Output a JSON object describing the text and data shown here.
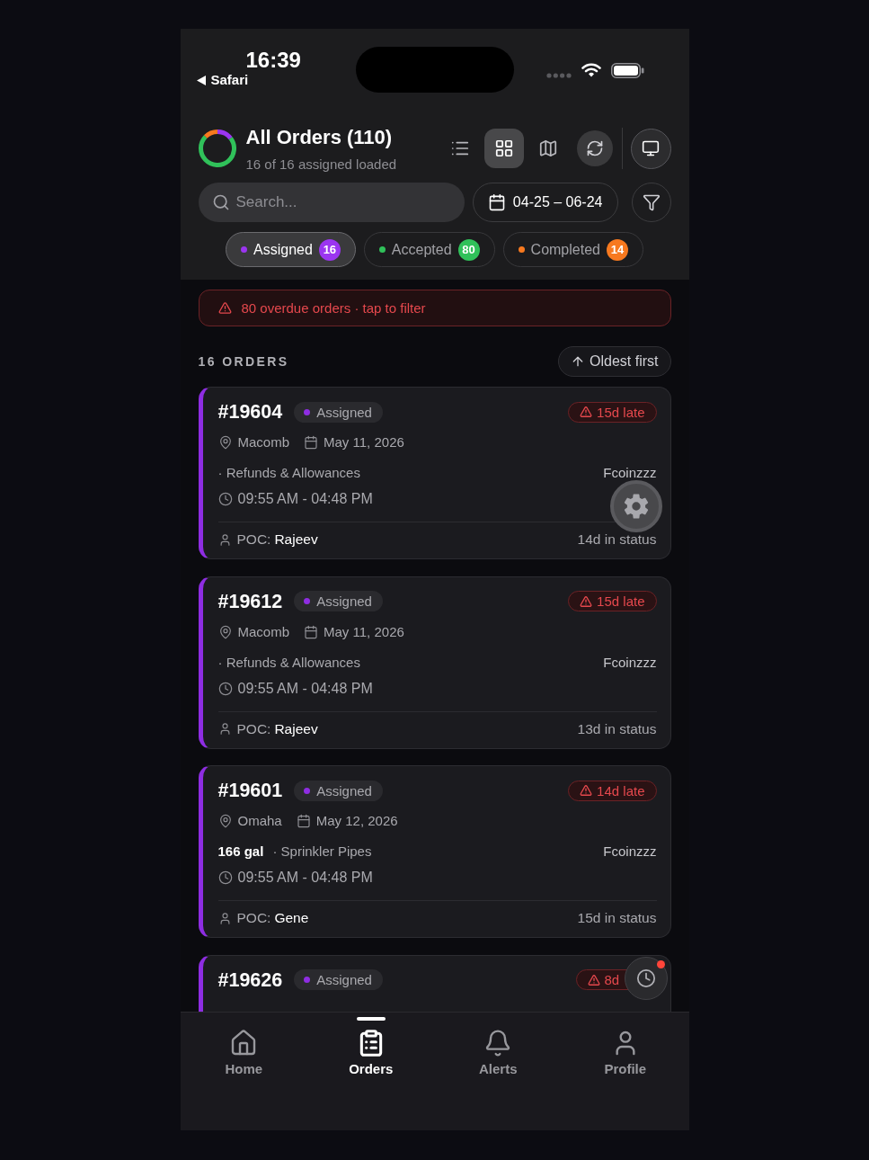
{
  "status_bar": {
    "time": "16:39",
    "back_label": "Safari"
  },
  "header": {
    "title": "All Orders (110)",
    "subtitle": "16 of 16 assigned loaded"
  },
  "view_modes": [
    {
      "kind": "list",
      "selected": false
    },
    {
      "kind": "grid",
      "selected": true
    },
    {
      "kind": "map",
      "selected": false
    }
  ],
  "search": {
    "placeholder": "Search..."
  },
  "date_range": {
    "label": "04-25 – 06-24"
  },
  "status_filters": [
    {
      "label": "Assigned",
      "count": "16",
      "color": "#9b35f0",
      "selected": true
    },
    {
      "label": "Accepted",
      "count": "80",
      "color": "#30c15a",
      "selected": false
    },
    {
      "label": "Completed",
      "count": "14",
      "color": "#f7791f",
      "selected": false
    }
  ],
  "overdue_banner": {
    "text": "80 overdue orders · tap to filter"
  },
  "list_header": {
    "count": "16 ORDERS",
    "sort": "Oldest first"
  },
  "orders": [
    {
      "number": "#19604",
      "status": "Assigned",
      "late": "15d late",
      "location": "Macomb",
      "date": "May 11, 2026",
      "category": "· Refunds & Allowances",
      "vendor": "Fcoinzzz",
      "time": "09:55 AM - 04:48 PM",
      "poc_label": "POC:",
      "poc": "Rajeev",
      "in_status": "14d in status"
    },
    {
      "number": "#19612",
      "status": "Assigned",
      "late": "15d late",
      "location": "Macomb",
      "date": "May 11, 2026",
      "category": "· Refunds & Allowances",
      "vendor": "Fcoinzzz",
      "time": "09:55 AM - 04:48 PM",
      "poc_label": "POC:",
      "poc": "Rajeev",
      "in_status": "13d in status"
    },
    {
      "number": "#19601",
      "status": "Assigned",
      "late": "14d late",
      "location": "Omaha",
      "date": "May 12, 2026",
      "quantity": "166 gal",
      "category": "· Sprinkler Pipes",
      "vendor": "Fcoinzzz",
      "time": "09:55 AM - 04:48 PM",
      "poc_label": "POC:",
      "poc": "Gene",
      "in_status": "15d in status"
    },
    {
      "number": "#19626",
      "status": "Assigned",
      "late": "8d"
    }
  ],
  "timer_button": {
    "alert": true
  },
  "tabs": [
    {
      "kind": "home",
      "label": "Home",
      "selected": false
    },
    {
      "kind": "orders",
      "label": "Orders",
      "selected": true
    },
    {
      "kind": "alerts",
      "label": "Alerts",
      "selected": false
    },
    {
      "kind": "profile",
      "label": "Profile",
      "selected": false
    }
  ]
}
